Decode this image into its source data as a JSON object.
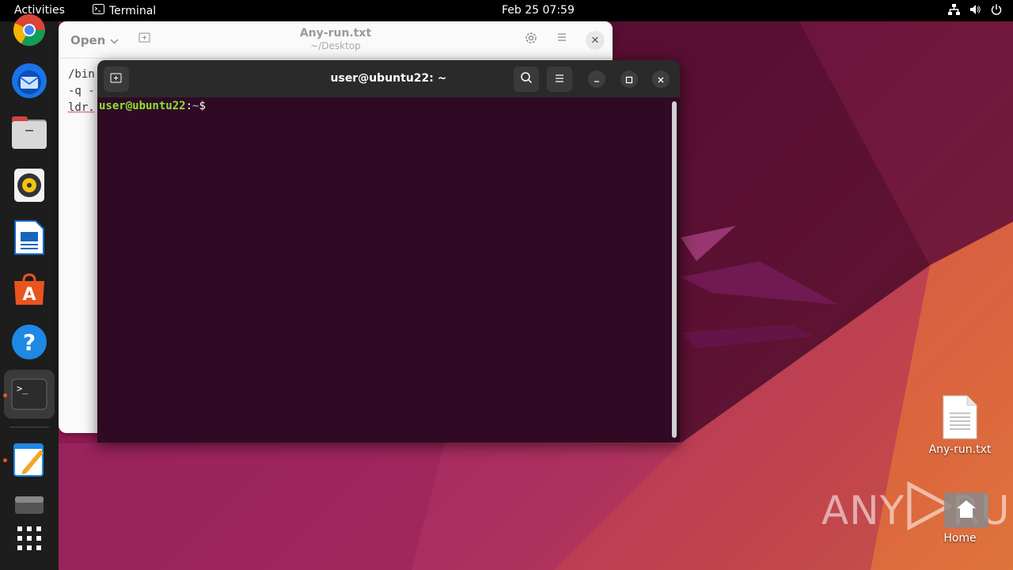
{
  "topbar": {
    "activities": "Activities",
    "app_name": "Terminal",
    "clock": "Feb 25  07:59",
    "tray_icons": [
      "network-icon",
      "volume-icon",
      "power-icon"
    ]
  },
  "dock": {
    "items": [
      "chrome-icon",
      "thunderbird-icon",
      "files-icon",
      "rhythmbox-icon",
      "writer-icon",
      "app-center-icon",
      "help-icon",
      "terminal-icon",
      "text-editor-icon",
      "drive-icon",
      "show-apps-icon"
    ]
  },
  "editor": {
    "open_label": "Open",
    "title": "Any-run.txt",
    "subtitle": "~/Desktop",
    "lines": [
      "/bin",
      "-q -",
      "ldr."
    ]
  },
  "terminal": {
    "title": "user@ubuntu22: ~",
    "prompt_user": "user@ubuntu22",
    "prompt_sep": ":",
    "prompt_path": "~",
    "prompt_symbol": "$"
  },
  "desktop": {
    "file_label": "Any-run.txt",
    "home_label": "Home"
  },
  "watermark": {
    "left": "ANY",
    "right": "RUN"
  },
  "colors": {
    "terminal_bg": "#300a24",
    "accent": "#e95420"
  }
}
